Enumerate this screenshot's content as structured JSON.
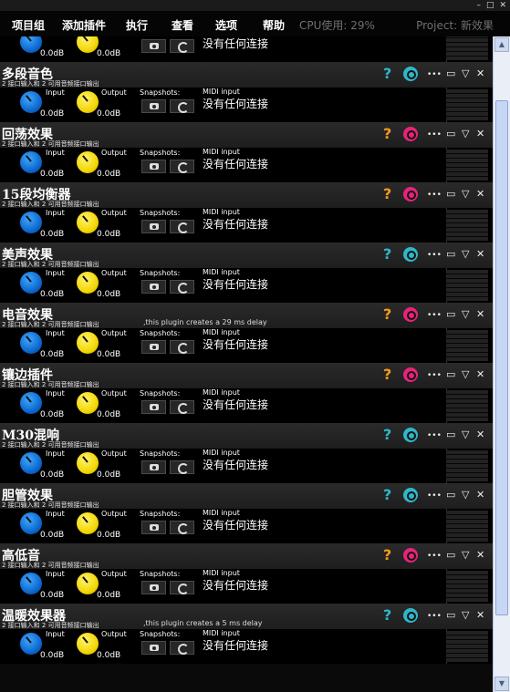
{
  "menu": {
    "items": [
      "项目组",
      "添加插件",
      "执行",
      "查看",
      "选项",
      "帮助"
    ],
    "cpu": "CPU使用: 29%",
    "project": "Project: 新效果"
  },
  "common": {
    "desc": "2 接口输入和 2 可用音频接口输出",
    "input_label": "Input",
    "output_label": "Output",
    "input_db": "0.0dB",
    "output_db": "0.0dB",
    "snapshots_label": "Snapshots:",
    "midi_label": "MIDI input",
    "midi_value": "没有任何连接"
  },
  "colors": {
    "teal_icon": "#2fb7c8",
    "orange_icon": "#f39a1e",
    "pink_icon": "#e8237a",
    "input_knob": "#1a7fe6",
    "output_knob": "#f2d400"
  },
  "plugins": [
    {
      "name": "",
      "icon_theme": "teal",
      "note": ""
    },
    {
      "name": "多段音色",
      "icon_theme": "teal",
      "note": ""
    },
    {
      "name": "回荡效果",
      "icon_theme": "orange",
      "note": ""
    },
    {
      "name": "15段均衡器",
      "icon_theme": "orange",
      "note": ""
    },
    {
      "name": "美声效果",
      "icon_theme": "teal",
      "note": ""
    },
    {
      "name": "电音效果",
      "icon_theme": "orange",
      "note": ",this plugin creates a 29 ms delay"
    },
    {
      "name": "镶边插件",
      "icon_theme": "orange",
      "note": ""
    },
    {
      "name": "M30混响",
      "icon_theme": "teal",
      "note": ""
    },
    {
      "name": "胆管效果",
      "icon_theme": "teal",
      "note": ""
    },
    {
      "name": "高低音",
      "icon_theme": "orange",
      "note": ""
    },
    {
      "name": "温暖效果器",
      "icon_theme": "teal",
      "note": ",this plugin creates a 5 ms delay"
    }
  ]
}
